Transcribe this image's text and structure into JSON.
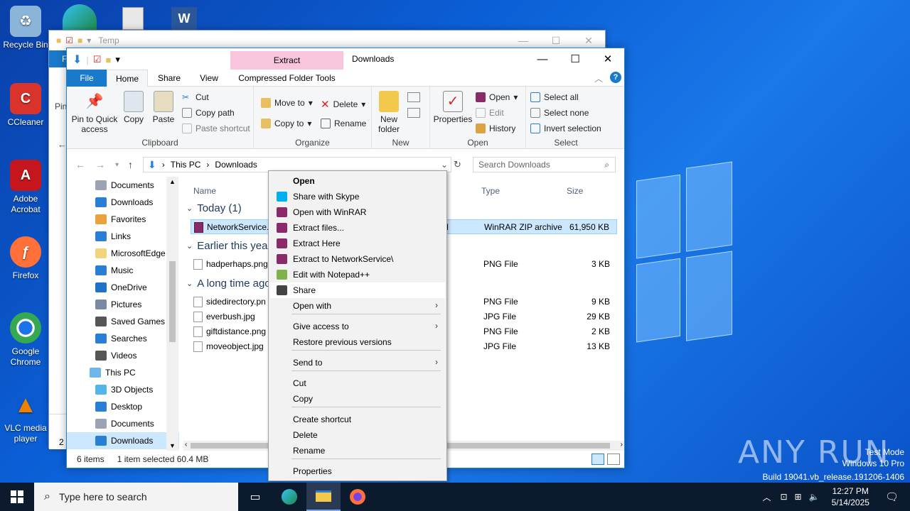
{
  "desktop": {
    "icons": [
      {
        "label": "Recycle Bin",
        "icon": "recycle-bin-icon",
        "color": "#8ab4d8"
      },
      {
        "label": "CCleaner",
        "icon": "ccleaner-icon",
        "color": "#d9342b"
      },
      {
        "label": "Adobe Acrobat",
        "icon": "acrobat-icon",
        "color": "#c4161c"
      },
      {
        "label": "Firefox",
        "icon": "firefox-icon",
        "color": "#ff7139"
      },
      {
        "label": "Google Chrome",
        "icon": "chrome-icon",
        "color": "#1a73e8"
      },
      {
        "label": "VLC media player",
        "icon": "vlc-icon",
        "color": "#f08000"
      }
    ],
    "watermark": {
      "line1": "Test Mode",
      "line2": "Windows 10 Pro",
      "line3": "Build 19041.vb_release.191206-1406"
    },
    "anyrun": "ANY  RUN"
  },
  "back_window": {
    "title": "Temp",
    "status": "2 i"
  },
  "window": {
    "title": "Downloads",
    "context_tab": "Extract",
    "tabs": {
      "file": "File",
      "home": "Home",
      "share": "Share",
      "view": "View",
      "compressed": "Compressed Folder Tools"
    },
    "ribbon": {
      "clipboard": {
        "label": "Clipboard",
        "pin": "Pin to Quick access",
        "copy": "Copy",
        "paste": "Paste",
        "cut": "Cut",
        "copy_path": "Copy path",
        "paste_shortcut": "Paste shortcut"
      },
      "organize": {
        "label": "Organize",
        "move_to": "Move to",
        "copy_to": "Copy to",
        "delete": "Delete",
        "rename": "Rename"
      },
      "new": {
        "label": "New",
        "new_folder": "New folder"
      },
      "open": {
        "label": "Open",
        "properties": "Properties",
        "open": "Open",
        "edit": "Edit",
        "history": "History"
      },
      "select": {
        "label": "Select",
        "select_all": "Select all",
        "select_none": "Select none",
        "invert": "Invert selection"
      }
    },
    "address": {
      "crumbs": [
        "This PC",
        "Downloads"
      ],
      "search_placeholder": "Search Downloads"
    },
    "nav_items": [
      {
        "label": "Documents",
        "color": "#9aa4b2",
        "indent": 40
      },
      {
        "label": "Downloads",
        "color": "#2a7fd4",
        "indent": 40
      },
      {
        "label": "Favorites",
        "color": "#e8a33c",
        "indent": 40
      },
      {
        "label": "Links",
        "color": "#2a7fd4",
        "indent": 40
      },
      {
        "label": "MicrosoftEdge",
        "color": "#f2d47a",
        "indent": 40
      },
      {
        "label": "Music",
        "color": "#2a7fd4",
        "indent": 40
      },
      {
        "label": "OneDrive",
        "color": "#1e73c8",
        "indent": 40
      },
      {
        "label": "Pictures",
        "color": "#7a8aa0",
        "indent": 40
      },
      {
        "label": "Saved Games",
        "color": "#555555",
        "indent": 40
      },
      {
        "label": "Searches",
        "color": "#2a7fd4",
        "indent": 40
      },
      {
        "label": "Videos",
        "color": "#555555",
        "indent": 40
      },
      {
        "label": "This PC",
        "color": "#6fb6ec",
        "indent": 32
      },
      {
        "label": "3D Objects",
        "color": "#55b4e8",
        "indent": 40
      },
      {
        "label": "Desktop",
        "color": "#2a7fd4",
        "indent": 40
      },
      {
        "label": "Documents",
        "color": "#9aa4b2",
        "indent": 40
      },
      {
        "label": "Downloads",
        "color": "#2a7fd4",
        "indent": 40
      }
    ],
    "columns": {
      "name": "Name",
      "type": "Type",
      "size": "Size"
    },
    "groups": [
      {
        "label": "Today (1)"
      },
      {
        "label": "Earlier this year"
      },
      {
        "label": "A long time ago"
      }
    ],
    "files": [
      {
        "name": "NetworkService.",
        "type": "WinRAR ZIP archive",
        "size": "61,950 KB",
        "frag": "M"
      },
      {
        "name": "hadperhaps.png",
        "type": "PNG File",
        "size": "3 KB",
        "frag": ""
      },
      {
        "name": "sidedirectory.pn",
        "type": "PNG File",
        "size": "9 KB",
        "frag": "M"
      },
      {
        "name": "everbush.jpg",
        "type": "JPG File",
        "size": "29 KB",
        "frag": ""
      },
      {
        "name": "giftdistance.png",
        "type": "PNG File",
        "size": "2 KB",
        "frag": ""
      },
      {
        "name": "moveobject.jpg",
        "type": "JPG File",
        "size": "13 KB",
        "frag": ""
      }
    ],
    "status": {
      "items": "6 items",
      "selected": "1 item selected  60.4 MB"
    }
  },
  "context_menu": {
    "items": [
      {
        "label": "Open",
        "bold": true,
        "icon": ""
      },
      {
        "label": "Share with Skype",
        "icon": "skype-icon",
        "color": "#00aff0"
      },
      {
        "label": "Open with WinRAR",
        "icon": "winrar-icon",
        "color": "#8b2a6b"
      },
      {
        "label": "Extract files...",
        "icon": "winrar-icon",
        "color": "#8b2a6b"
      },
      {
        "label": "Extract Here",
        "icon": "winrar-icon",
        "color": "#8b2a6b"
      },
      {
        "label": "Extract to NetworkService\\",
        "icon": "winrar-icon",
        "color": "#8b2a6b"
      },
      {
        "label": "Edit with Notepad++",
        "icon": "notepadpp-icon",
        "color": "#7fb24a"
      },
      {
        "label": "Share",
        "icon": "share-icon",
        "color": "#444444"
      },
      {
        "label": "Open with",
        "submenu": true
      },
      {
        "label": "Give access to",
        "submenu": true
      },
      {
        "label": "Restore previous versions"
      },
      {
        "label": "Send to",
        "submenu": true
      },
      {
        "label": "Cut"
      },
      {
        "label": "Copy"
      },
      {
        "label": "Create shortcut"
      },
      {
        "label": "Delete"
      },
      {
        "label": "Rename"
      },
      {
        "label": "Properties"
      }
    ]
  },
  "taskbar": {
    "search_placeholder": "Type here to search",
    "time": "12:27 PM",
    "date": "5/14/2025"
  }
}
